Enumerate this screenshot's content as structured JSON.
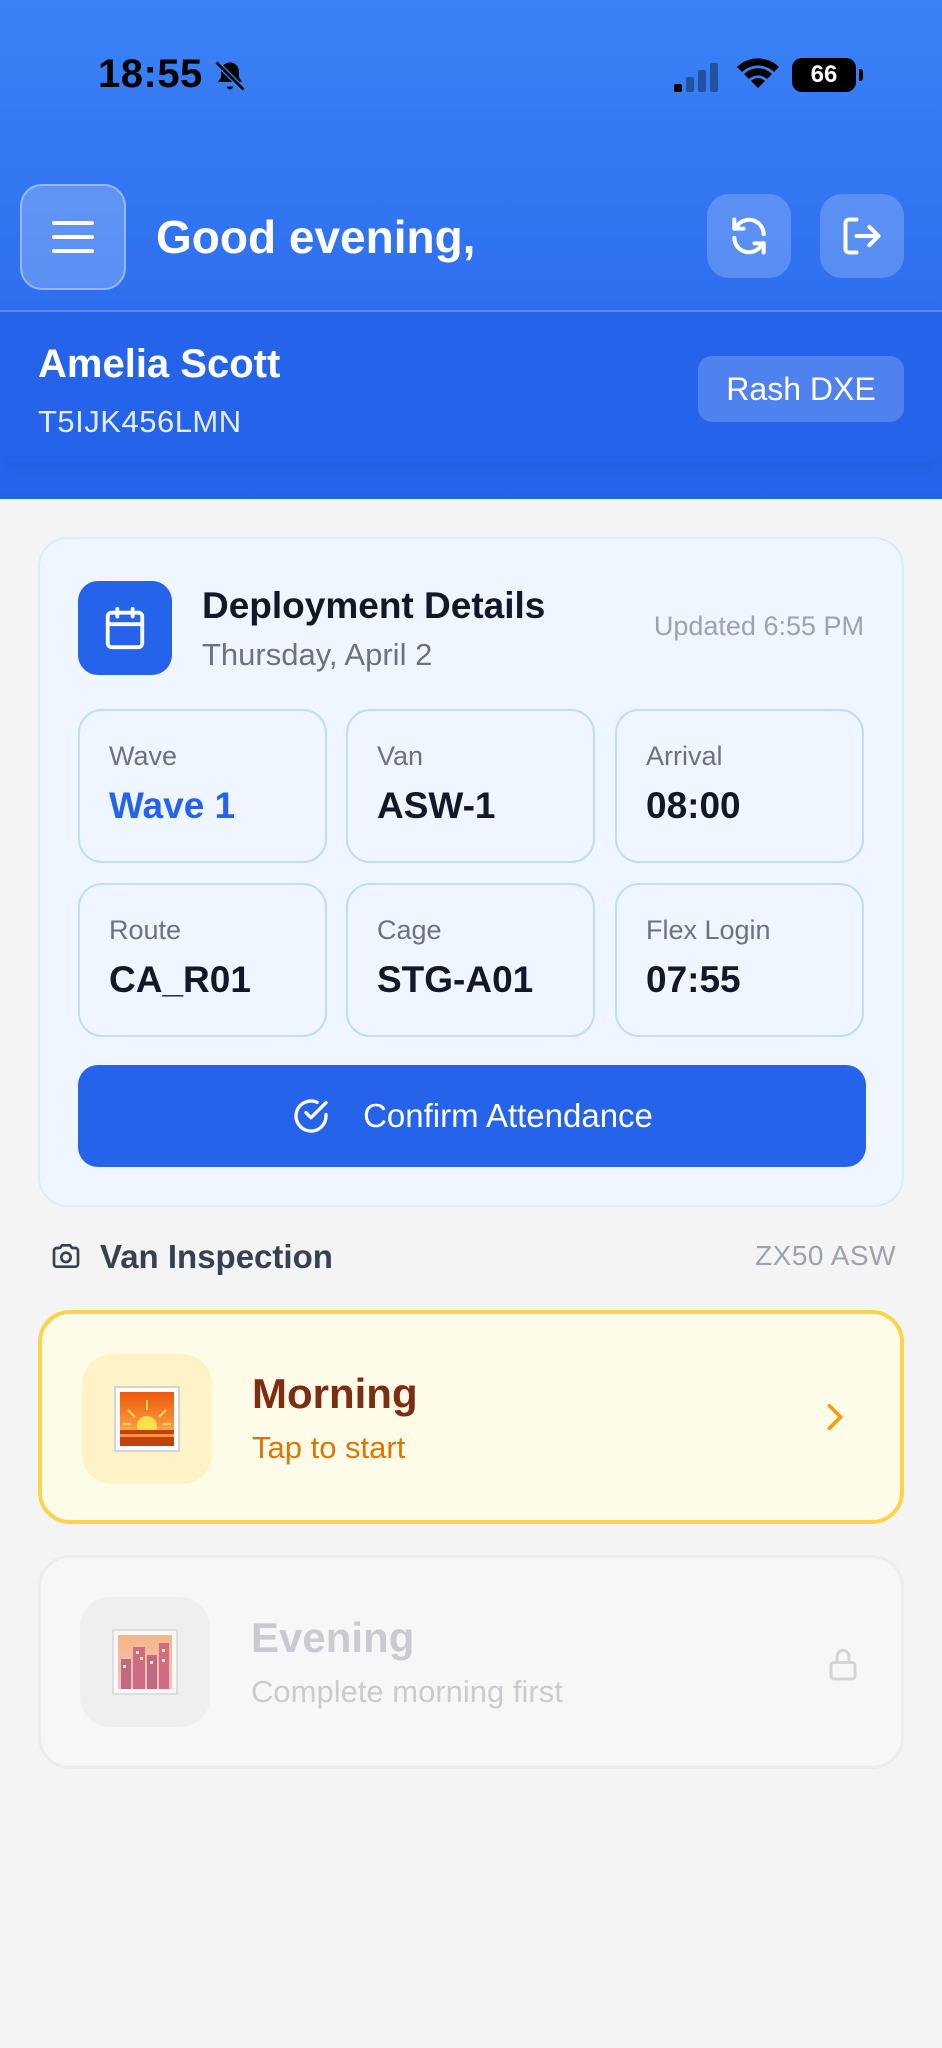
{
  "status_bar": {
    "time": "18:55",
    "battery": "66"
  },
  "header": {
    "greeting": "Good evening,",
    "user_name": "Amelia Scott",
    "user_id": "T5IJK456LMN",
    "station": "Rash DXE",
    "icons": [
      "menu-icon",
      "refresh-icon",
      "logout-icon"
    ]
  },
  "deployment": {
    "title": "Deployment Details",
    "date": "Thursday, April 2",
    "updated": "Updated 6:55 PM",
    "tiles": [
      {
        "label": "Wave",
        "value": "Wave 1"
      },
      {
        "label": "Van",
        "value": "ASW-1"
      },
      {
        "label": "Arrival",
        "value": "08:00"
      },
      {
        "label": "Route",
        "value": "CA_R01"
      },
      {
        "label": "Cage",
        "value": "STG-A01"
      },
      {
        "label": "Flex Login",
        "value": "07:55"
      }
    ],
    "confirm_label": "Confirm Attendance"
  },
  "inspection": {
    "title": "Van Inspection",
    "plate": "ZX50 ASW",
    "morning": {
      "title": "Morning",
      "subtitle": "Tap to start",
      "icon": "sunrise-icon"
    },
    "evening": {
      "title": "Evening",
      "subtitle": "Complete morning first",
      "icon": "city-dusk-icon",
      "locked": true
    }
  },
  "colors": {
    "primary": "#2563eb",
    "header_top": "#3b82f6",
    "morning_border": "#fcd34d",
    "morning_accent": "#d97706"
  }
}
